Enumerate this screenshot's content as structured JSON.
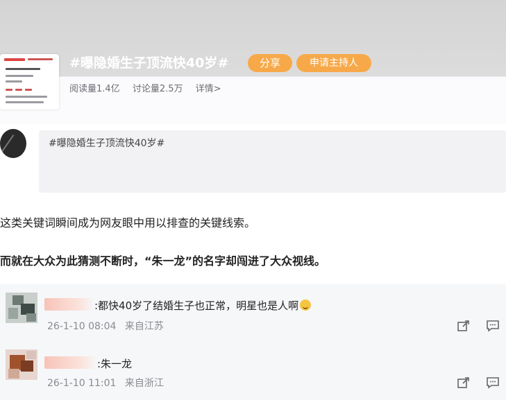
{
  "topic": {
    "title": "#曝隐婚生子顶流快40岁#",
    "share_label": "分享",
    "host_label": "申请主持人",
    "reads": "阅读量1.4亿",
    "discussions": "讨论量2.5万",
    "details": "详情>"
  },
  "composer": {
    "text": "#曝隐婚生子顶流快40岁#"
  },
  "article": {
    "para1": "这类关键词瞬间成为网友眼中用以排查的关键线索。",
    "para2": "而就在大众为此猜测不断时，“朱一龙”的名字却闯进了大众视线。"
  },
  "comments": [
    {
      "text": ":都快40岁了结婚生子也正常，明星也是人啊",
      "date": "26-1-10 08:04",
      "location": "来自江苏"
    },
    {
      "text": ":朱一龙",
      "date": "26-1-10 11:01",
      "location": "来自浙江"
    }
  ],
  "colors": {
    "accent": "#f7a94a",
    "banner": "#d8d8d8",
    "comment_bg": "#f6f7f9",
    "meta": "#8a8a90"
  },
  "icons": {
    "forward": "share-arrow-icon",
    "comment": "speech-bubble-icon",
    "emoji": "smile-emoji-icon"
  }
}
